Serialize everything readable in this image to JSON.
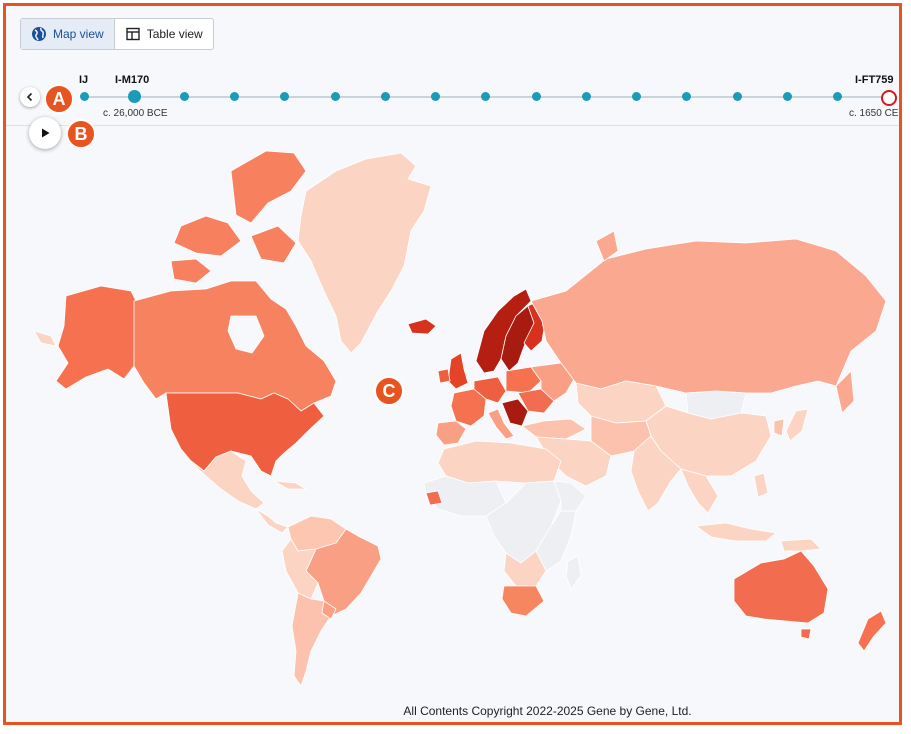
{
  "view_toggle": {
    "map_label": "Map view",
    "table_label": "Table view",
    "active": "map"
  },
  "timeline": {
    "start_label": "IJ",
    "marker_label": "I-M170",
    "marker_date": "c. 26,000 BCE",
    "end_label": "I-FT759",
    "end_date": "c. 1650 CE",
    "step_count": 17
  },
  "annotations": {
    "a": "A",
    "b": "B",
    "c": "C"
  },
  "colors": {
    "accent": "#e8531f",
    "timeline_dot": "#1a9bb8",
    "end_marker": "#d7191c",
    "no_data": "#eeeff3",
    "very_low": "#fdd9cc",
    "low": "#fcc2ad",
    "medium": "#f99f84",
    "high": "#f26c4f",
    "very_high": "#d8321e",
    "highest": "#a81b10"
  },
  "icons": {
    "prev": "chevron-left-icon",
    "play": "play-icon",
    "map": "globe-icon",
    "table": "table-icon"
  },
  "copyright": "All Contents Copyright 2022-2025 Gene by Gene, Ltd."
}
